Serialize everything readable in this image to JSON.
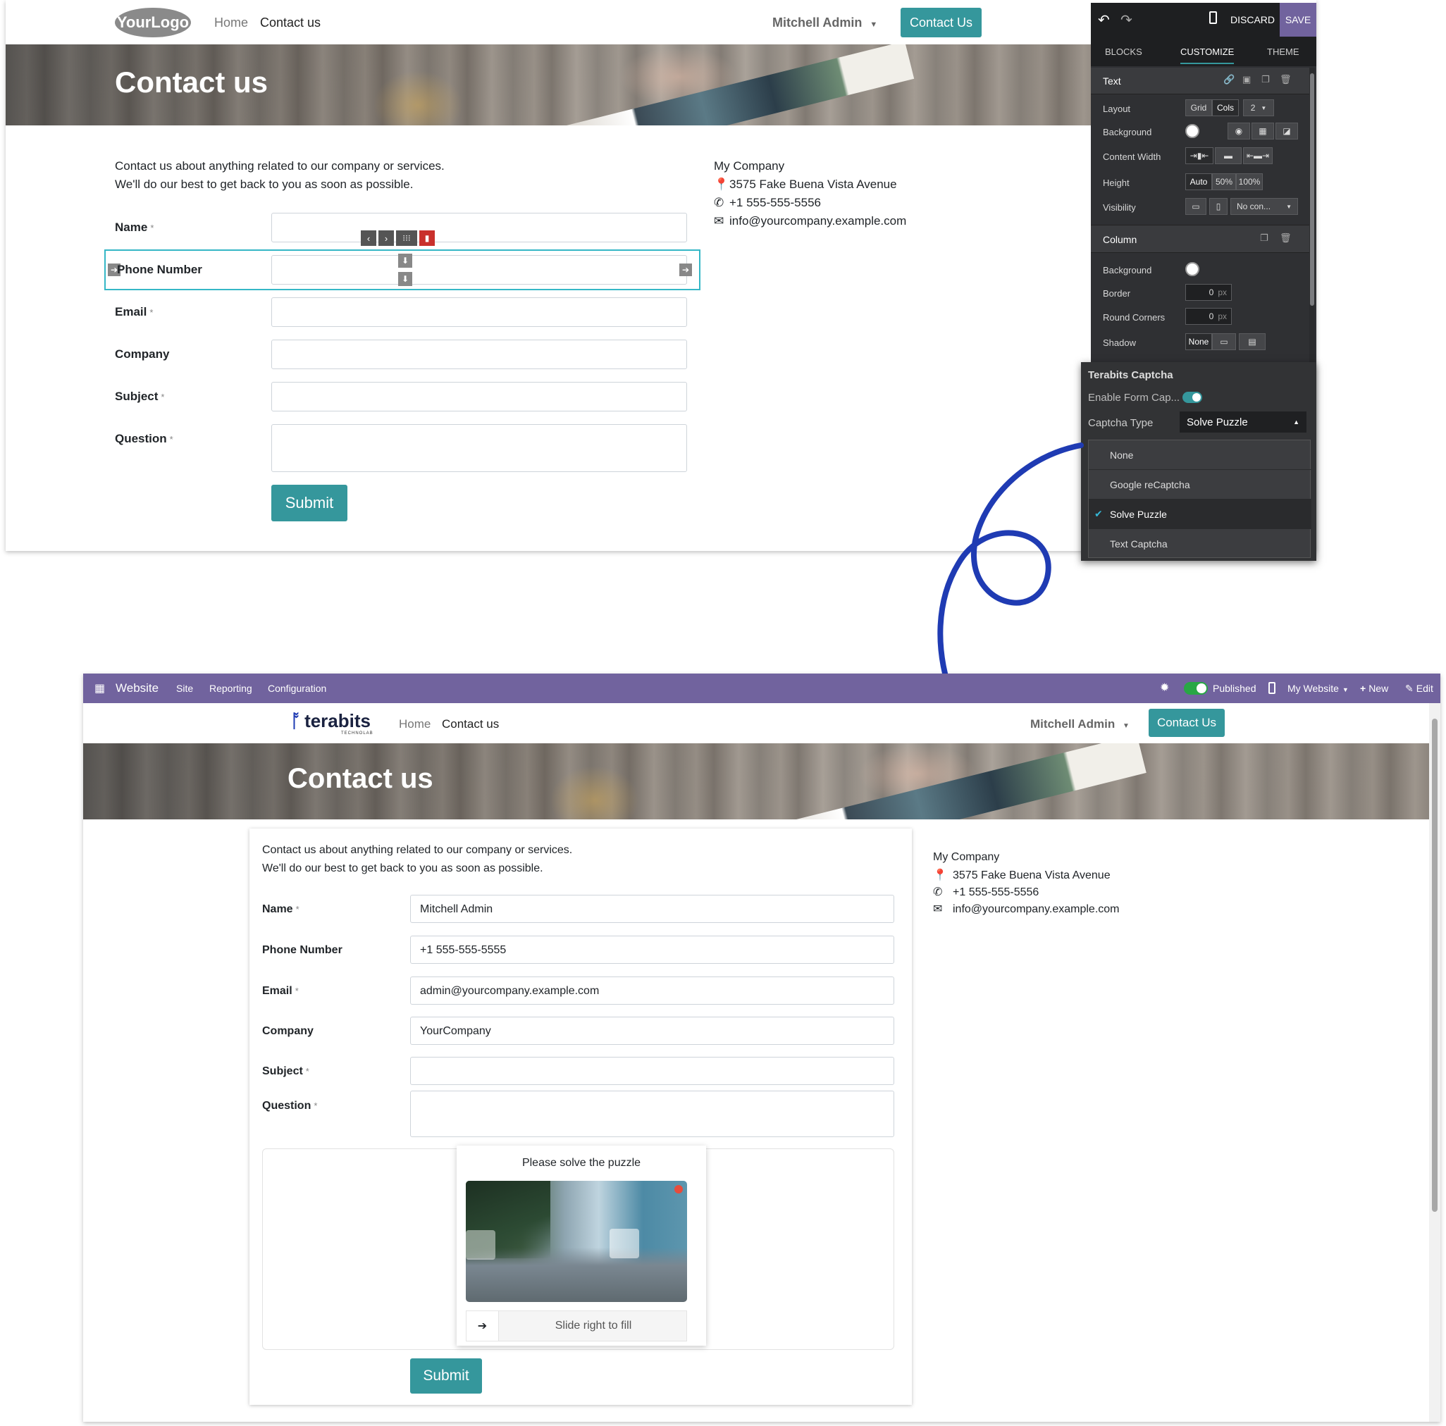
{
  "top": {
    "logo": "YourLogo",
    "nav": {
      "home": "Home",
      "contact": "Contact us"
    },
    "user": "Mitchell Admin",
    "cta": "Contact Us",
    "hero_title": "Contact us",
    "intro1": "Contact us about anything related to our company or services.",
    "intro2": "We'll do our best to get back to you as soon as possible.",
    "fields": {
      "name": "Name",
      "phone": "Phone Number",
      "email": "Email",
      "company": "Company",
      "subject": "Subject",
      "question": "Question"
    },
    "req_mark": "*",
    "submit": "Submit",
    "company": {
      "name": "My Company",
      "address": "3575 Fake Buena Vista Avenue",
      "phone": "+1 555-555-5556",
      "email": "info@yourcompany.example.com"
    }
  },
  "editor": {
    "discard": "DISCARD",
    "save": "SAVE",
    "tabs": {
      "blocks": "BLOCKS",
      "customize": "CUSTOMIZE",
      "theme": "THEME"
    },
    "text_section": "Text",
    "layout": "Layout",
    "grid": "Grid",
    "cols": "Cols",
    "cols_value": "2",
    "background": "Background",
    "content_width": "Content Width",
    "height": "Height",
    "auto": "Auto",
    "h50": "50%",
    "h100": "100%",
    "visibility": "Visibility",
    "no_cond": "No con...",
    "column_section": "Column",
    "border": "Border",
    "round_corners": "Round Corners",
    "px_value": "0",
    "px_unit": "px",
    "shadow": "Shadow",
    "none": "None",
    "captcha_section": "Terabits Captcha",
    "enable_captcha": "Enable Form Cap...",
    "captcha_type": "Captcha Type",
    "captcha_selected": "Solve Puzzle",
    "options": [
      "None",
      "Google reCaptcha",
      "Solve Puzzle",
      "Text Captcha"
    ],
    "selected_color": "#35979c"
  },
  "bottom": {
    "app": "Website",
    "menu": {
      "site": "Site",
      "reporting": "Reporting",
      "configuration": "Configuration"
    },
    "published": "Published",
    "my_website": "My Website",
    "new": "New",
    "edit": "Edit",
    "logo": "terabits",
    "logo_sub": "TECHNOLAB",
    "nav": {
      "home": "Home",
      "contact": "Contact us"
    },
    "user": "Mitchell Admin",
    "cta": "Contact Us",
    "hero_title": "Contact us",
    "intro1": "Contact us about anything related to our company or services.",
    "intro2": "We'll do our best to get back to you as soon as possible.",
    "values": {
      "name": "Mitchell Admin",
      "phone": "+1 555-555-5555",
      "email": "admin@yourcompany.example.com",
      "company": "YourCompany",
      "subject": "",
      "question": ""
    },
    "puzzle_title": "Please solve the puzzle",
    "slide_text": "Slide right to fill",
    "submit": "Submit",
    "company": {
      "name": "My Company",
      "address": "3575 Fake Buena Vista Avenue",
      "phone": "+1 555-555-5556",
      "email": "info@yourcompany.example.com"
    }
  },
  "colors": {
    "teal": "#35979c",
    "odoo_purple": "#71639e",
    "arrow_blue": "#1f3bb3",
    "panel_dark": "#2f3033"
  }
}
